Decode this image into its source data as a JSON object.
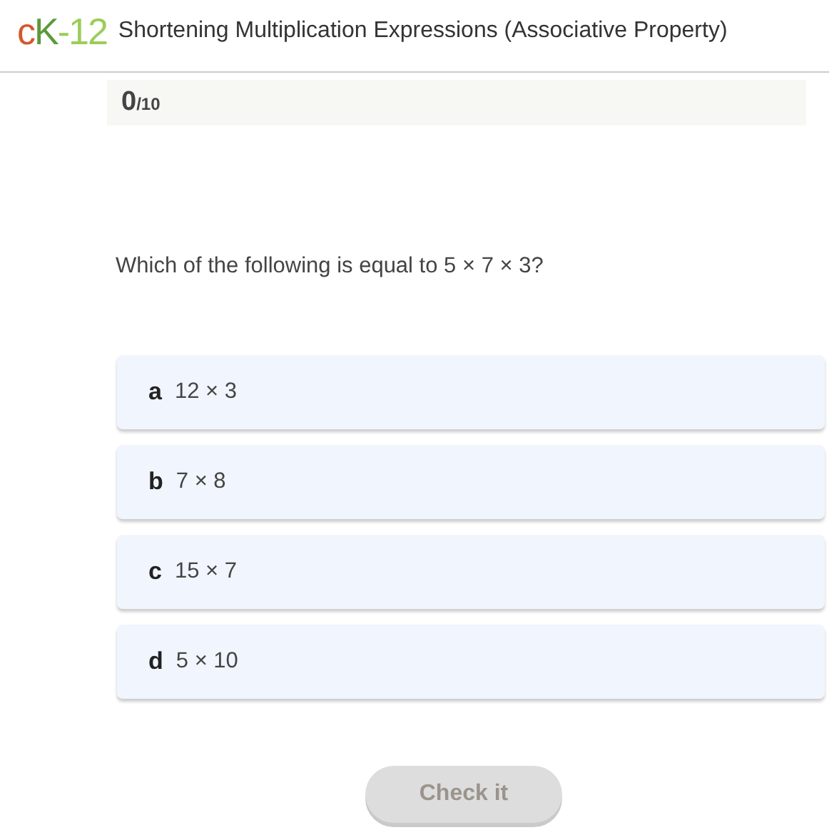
{
  "header": {
    "logo": [
      {
        "text": "c",
        "color": "#d4582a"
      },
      {
        "text": "K",
        "color": "#5a9a3a"
      },
      {
        "text": "-12",
        "color": "#9ccc5a"
      }
    ],
    "title": "Shortening Multiplication Expressions (Associative Property)"
  },
  "score": {
    "value": "0",
    "total": "/10"
  },
  "question": "Which of the following is equal to 5 × 7 × 3?",
  "options": [
    {
      "letter": "a",
      "text": "12 × 3",
      "selected": false
    },
    {
      "letter": "b",
      "text": "7 × 8",
      "selected": false
    },
    {
      "letter": "c",
      "text": "15 × 7",
      "selected": false
    },
    {
      "letter": "d",
      "text": "5 × 10",
      "selected": false
    }
  ],
  "check_button": {
    "label": "Check it",
    "disabled": true
  }
}
